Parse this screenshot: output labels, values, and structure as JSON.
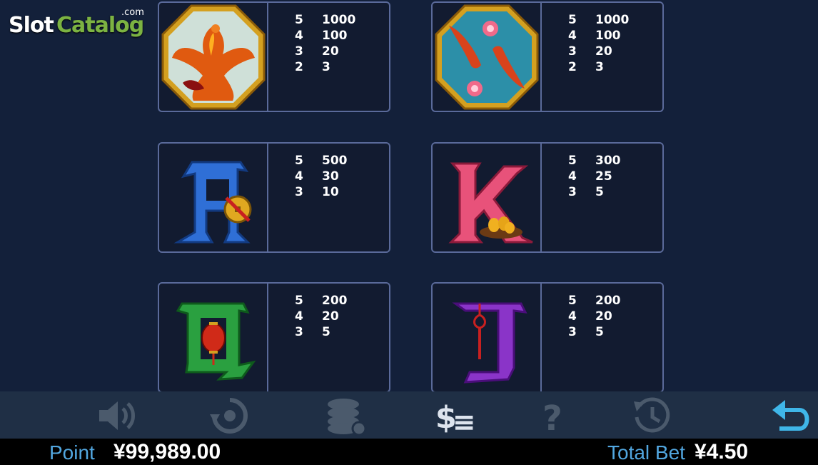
{
  "logo": {
    "part1": "Slot",
    "part2": "Catalog",
    "suffix": ".com"
  },
  "symbols": [
    {
      "name": "phoenix",
      "pays": [
        [
          "5",
          "1000"
        ],
        [
          "4",
          "100"
        ],
        [
          "3",
          "20"
        ],
        [
          "2",
          "3"
        ]
      ]
    },
    {
      "name": "koi-fish",
      "pays": [
        [
          "5",
          "1000"
        ],
        [
          "4",
          "100"
        ],
        [
          "3",
          "20"
        ],
        [
          "2",
          "3"
        ]
      ]
    },
    {
      "name": "A",
      "pays": [
        [
          "5",
          "500"
        ],
        [
          "4",
          "30"
        ],
        [
          "3",
          "10"
        ]
      ]
    },
    {
      "name": "K",
      "pays": [
        [
          "5",
          "300"
        ],
        [
          "4",
          "25"
        ],
        [
          "3",
          "5"
        ]
      ]
    },
    {
      "name": "Q",
      "pays": [
        [
          "5",
          "200"
        ],
        [
          "4",
          "20"
        ],
        [
          "3",
          "5"
        ]
      ]
    },
    {
      "name": "J",
      "pays": [
        [
          "5",
          "200"
        ],
        [
          "4",
          "20"
        ],
        [
          "3",
          "5"
        ]
      ]
    }
  ],
  "toolbar": [
    "sound-icon",
    "autospin-icon",
    "chips-icon",
    "paytable-icon",
    "help-icon",
    "history-icon",
    "back-icon"
  ],
  "footer": {
    "point_label": "Point",
    "point_value": "¥99,989.00",
    "bet_label": "Total Bet",
    "bet_value": "¥4.50"
  },
  "colors": {
    "accent": "#52a7e0",
    "frame": "#5a6a9a",
    "back": "#3fb6e8"
  }
}
